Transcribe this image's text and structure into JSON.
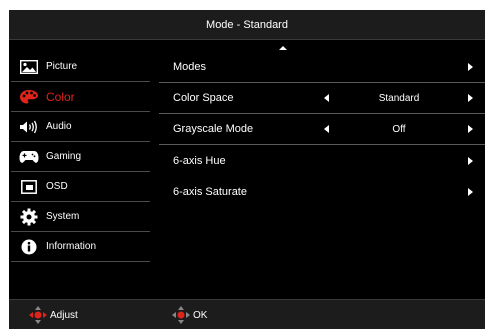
{
  "title": "Mode - Standard",
  "colors": {
    "accent": "#e0231b",
    "background": "#000000",
    "panel": "#1c1c1c",
    "separator": "#5a5a5a"
  },
  "sidebar": {
    "items": [
      {
        "label": "Picture",
        "icon": "picture-icon"
      },
      {
        "label": "Color",
        "icon": "palette-icon",
        "active": true
      },
      {
        "label": "Audio",
        "icon": "speaker-icon"
      },
      {
        "label": "Gaming",
        "icon": "gamepad-icon"
      },
      {
        "label": "OSD",
        "icon": "osd-window-icon"
      },
      {
        "label": "System",
        "icon": "gear-icon"
      },
      {
        "label": "Information",
        "icon": "info-icon"
      }
    ]
  },
  "main": {
    "rows": [
      {
        "label": "Modes"
      },
      {
        "label": "Color Space",
        "value": "Standard"
      },
      {
        "label": "Grayscale Mode",
        "value": "Off"
      },
      {
        "label": "6-axis Hue"
      },
      {
        "label": "6-axis Saturate"
      }
    ]
  },
  "footer": {
    "adjust_label": "Adjust",
    "ok_label": "OK"
  }
}
